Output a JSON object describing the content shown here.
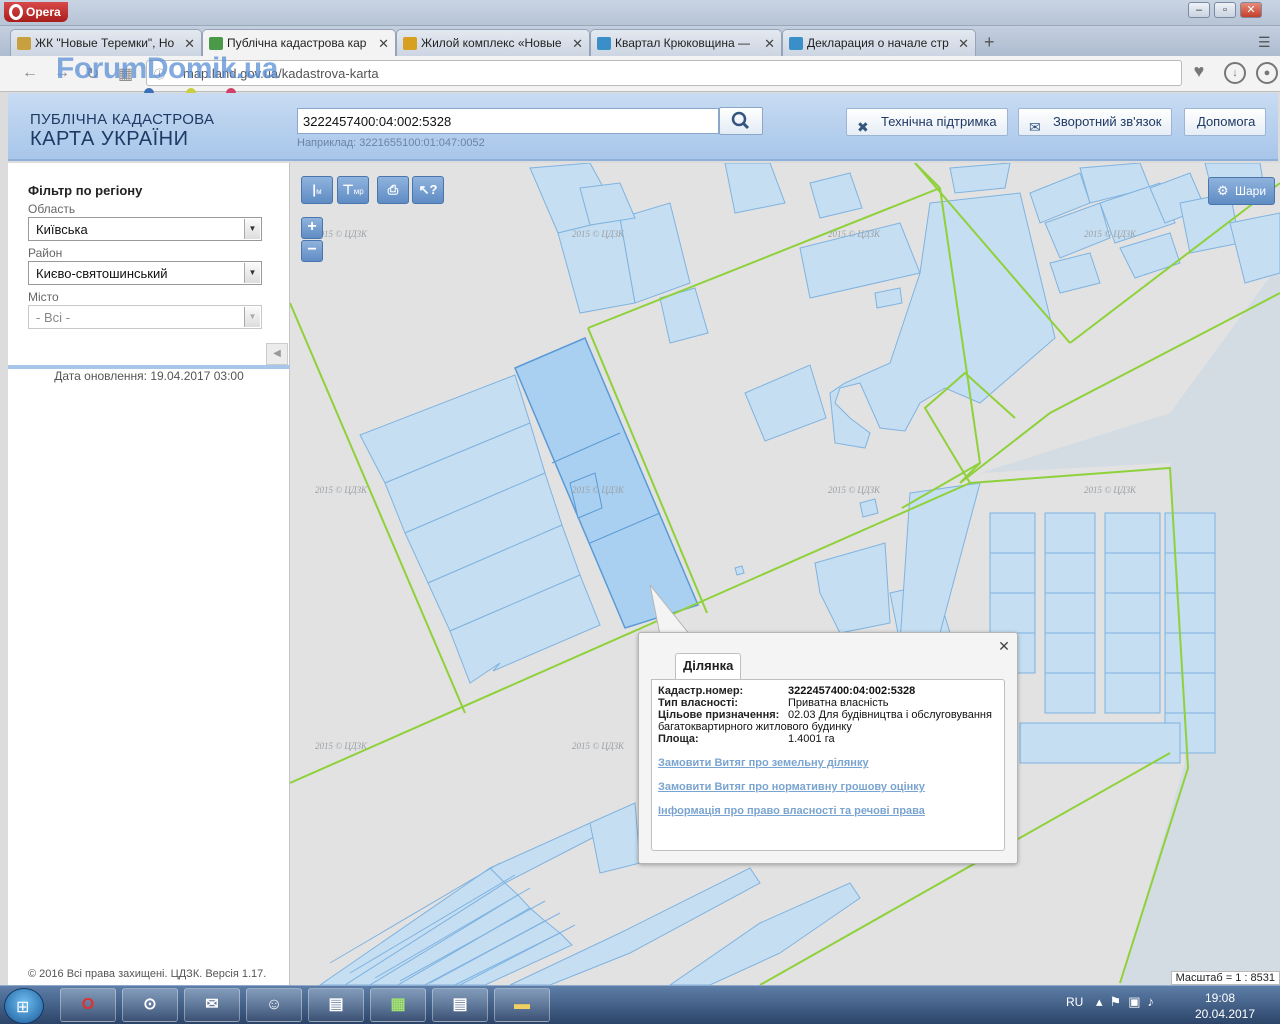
{
  "browser": {
    "app_name": "Opera",
    "tabs": [
      {
        "label": "ЖК \"Новые Теремки\", Но",
        "fav": "#c8a040"
      },
      {
        "label": "Публічна кадастрова кар",
        "fav": "#4a9a4a"
      },
      {
        "label": "Жилой комплекс «Новые",
        "fav": "#d8a020"
      },
      {
        "label": "Квартал Крюковщина —",
        "fav": "#3b8fc8"
      },
      {
        "label": "Декларация о начале стр",
        "fav": "#3b8fc8"
      }
    ],
    "url": "map.land.gov.ua/kadastrova-karta",
    "watermark": "ForumDomik.ua"
  },
  "header": {
    "logo_line1": "ПУБЛІЧНА КАДАСТРОВА",
    "logo_line2": "КАРТА УКРАЇНИ",
    "search_value": "3222457400:04:002:5328",
    "search_hint": "Наприклад: 3221655100:01:047:0052",
    "buttons": {
      "support": "Технічна підтримка",
      "feedback": "Зворотний зв'язок",
      "help": "Допомога"
    }
  },
  "sidebar": {
    "title": "Фільтр по регіону",
    "oblast_label": "Область",
    "oblast_value": "Київська",
    "rayon_label": "Район",
    "rayon_value": "Києво-святошинський",
    "city_label": "Місто",
    "city_value": "- Всі -",
    "update_text": "Дата оновлення: 19.04.2017 03:00",
    "copyright": "© 2016 Всі права захищені. ЦДЗК. Версія 1.17."
  },
  "map": {
    "tools": [
      "м",
      "мр"
    ],
    "layers_button": "Шари",
    "watermark_text": "2015 © ЦДЗК",
    "scale_text": "Масштаб = 1 : 8531",
    "colors": {
      "parcel_fill": "#c5def2",
      "parcel_stroke": "#7fb3e0",
      "boundary": "#8fd13a",
      "selected": "#a9d0f0"
    }
  },
  "popup": {
    "tab_label": "Ділянка",
    "rows": [
      {
        "key": "Кадастр.номер:",
        "value": "3222457400:04:002:5328"
      },
      {
        "key": "Тип власності:",
        "value": "Приватна власність"
      },
      {
        "key": "Цільове призначення:",
        "value": "02.03 Для будівництва і обслуговування"
      },
      {
        "key": "",
        "value": "багатоквартирного житлового будинку"
      },
      {
        "key": "Площа:",
        "value": "1.4001 га"
      }
    ],
    "links": [
      "Замовити Витяг про земельну ділянку",
      "Замовити Витяг про нормативну грошову оцінку",
      "Інформація про право власності та речові права"
    ]
  },
  "taskbar": {
    "lang": "RU",
    "time": "19:08",
    "date": "20.04.2017"
  }
}
